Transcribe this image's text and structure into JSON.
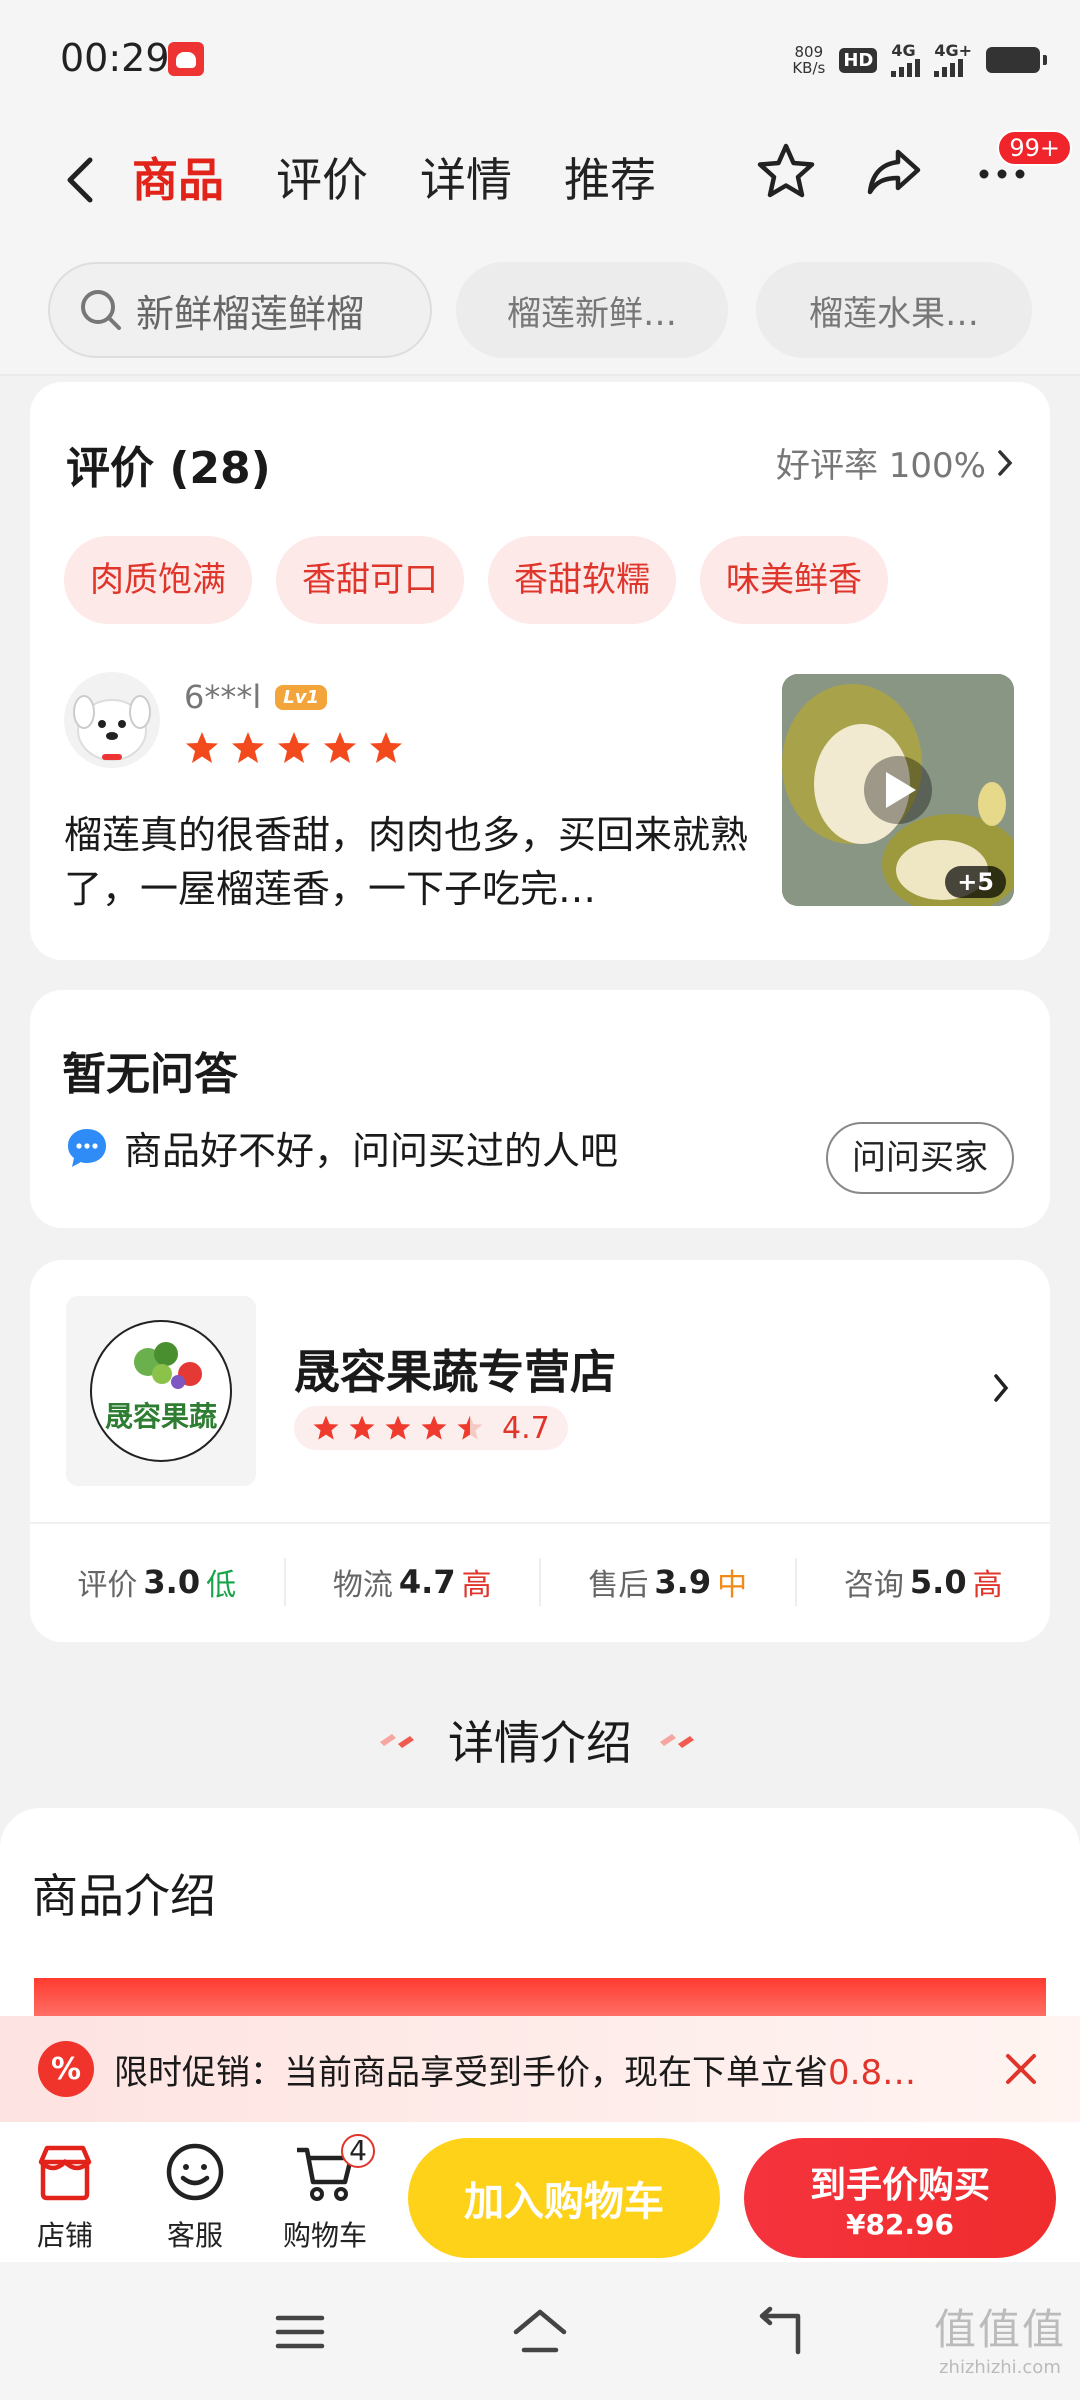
{
  "status_bar": {
    "time": "00:29",
    "net_speed_value": "809",
    "net_speed_unit": "KB/s",
    "hd_label": "HD",
    "sim1": "4G",
    "sim2": "4G+"
  },
  "nav": {
    "tabs": [
      {
        "label": "商品",
        "active": true
      },
      {
        "label": "评价",
        "active": false
      },
      {
        "label": "详情",
        "active": false
      },
      {
        "label": "推荐",
        "active": false
      }
    ],
    "message_badge": "99+"
  },
  "search_chips": {
    "search_text": "新鲜榴莲鲜榴",
    "chips": [
      "榴莲新鲜…",
      "榴莲水果…"
    ]
  },
  "reviews": {
    "title": "评价 (28)",
    "good_rate": "好评率 100%",
    "tags": [
      "肉质饱满",
      "香甜可口",
      "香甜软糯",
      "味美鲜香"
    ],
    "item": {
      "user": "6***l",
      "level_badge": "Lv1",
      "rating": 5,
      "text": "榴莲真的很香甜，肉肉也多，买回来就熟了，一屋榴莲香，一下子吃完…",
      "photo_count": "+5"
    }
  },
  "qa": {
    "title": "暂无问答",
    "prompt": "商品好不好，问问买过的人吧",
    "ask_button": "问问买家"
  },
  "store": {
    "logo_text": "晟容果蔬",
    "name": "晟容果蔬专营店",
    "rating": "4.7",
    "rating_value": 4.7,
    "metrics": [
      {
        "label": "评价",
        "score": "3.0",
        "level": "低",
        "tone": "low"
      },
      {
        "label": "物流",
        "score": "4.7",
        "level": "高",
        "tone": "high"
      },
      {
        "label": "售后",
        "score": "3.9",
        "level": "中",
        "tone": "mid"
      },
      {
        "label": "咨询",
        "score": "5.0",
        "level": "高",
        "tone": "high"
      }
    ]
  },
  "detail": {
    "section_title": "详情介绍",
    "intro_title": "商品介绍"
  },
  "promo": {
    "icon_text": "%",
    "text": "限时促销：当前商品享受到手价，现在下单立省",
    "highlight": "0.8…"
  },
  "bottom_bar": {
    "shop": "店铺",
    "service": "客服",
    "cart": "购物车",
    "cart_count": "4",
    "add_to_cart": "加入购物车",
    "buy_label": "到手价购买",
    "buy_price": "¥82.96"
  },
  "watermark": {
    "line1": "值值值",
    "line2": "zhizhizhi.com"
  },
  "colors": {
    "accent": "#e2231a",
    "tag_bg": "#fde9e8",
    "add_cart": "#ffd21a",
    "buy_now": "#f5333d"
  }
}
